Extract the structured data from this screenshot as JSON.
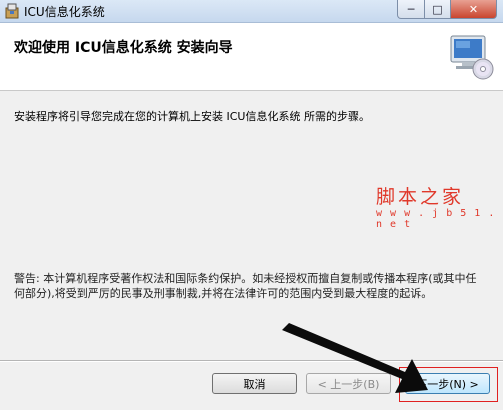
{
  "window": {
    "title": "ICU信息化系统",
    "min_label": "─",
    "max_label": "□",
    "close_label": "✕"
  },
  "header": {
    "title": "欢迎使用 ICU信息化系统 安装向导"
  },
  "content": {
    "intro": "安装程序将引导您完成在您的计算机上安装 ICU信息化系统 所需的步骤。",
    "warning": "警告: 本计算机程序受著作权法和国际条约保护。如未经授权而擅自复制或传播本程序(或其中任何部分),将受到严厉的民事及刑事制裁,并将在法律许可的范围内受到最大程度的起诉。"
  },
  "watermark": {
    "brand": "脚本之家",
    "url": "w w w . j b 5 1 . n e t"
  },
  "buttons": {
    "cancel": "取消",
    "back": "< 上一步(B)",
    "next": "下一步(N) >"
  },
  "colors": {
    "watermark": "#e0382a",
    "highlight": "#e02020",
    "next_button_border": "#3c7fb1"
  }
}
